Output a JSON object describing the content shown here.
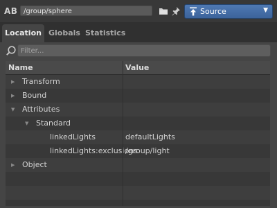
{
  "toolbar": {
    "ab_label": "AB",
    "path_value": "/group/sphere",
    "icons": [
      "folder-icon",
      "pin-icon"
    ],
    "source": {
      "label": "Source",
      "icon": "source-icon",
      "arrow": "▼"
    }
  },
  "tabs": [
    {
      "label": "Location",
      "active": true
    },
    {
      "label": "Globals",
      "active": false
    },
    {
      "label": "Statistics",
      "active": false
    }
  ],
  "filter": {
    "placeholder": "Filter...",
    "value": ""
  },
  "table": {
    "columns": [
      "Name",
      "Value"
    ],
    "rows": [
      {
        "name": "Transform",
        "value": "",
        "expander": "▶"
      },
      {
        "name": "Bound",
        "value": "",
        "expander": "▶"
      },
      {
        "name": "Attributes",
        "value": "",
        "expander": "▼"
      },
      {
        "name": "Standard",
        "value": "",
        "expander": "▼"
      },
      {
        "name": "linkedLights",
        "value": "defaultLights",
        "expander": ""
      },
      {
        "name": "linkedLights:exclusions",
        "value": "/group/light",
        "expander": ""
      },
      {
        "name": "Object",
        "value": "",
        "expander": "▶"
      }
    ]
  },
  "colors": {
    "background": "#303030",
    "panel": "#454545",
    "accent": "#4a72ab"
  }
}
